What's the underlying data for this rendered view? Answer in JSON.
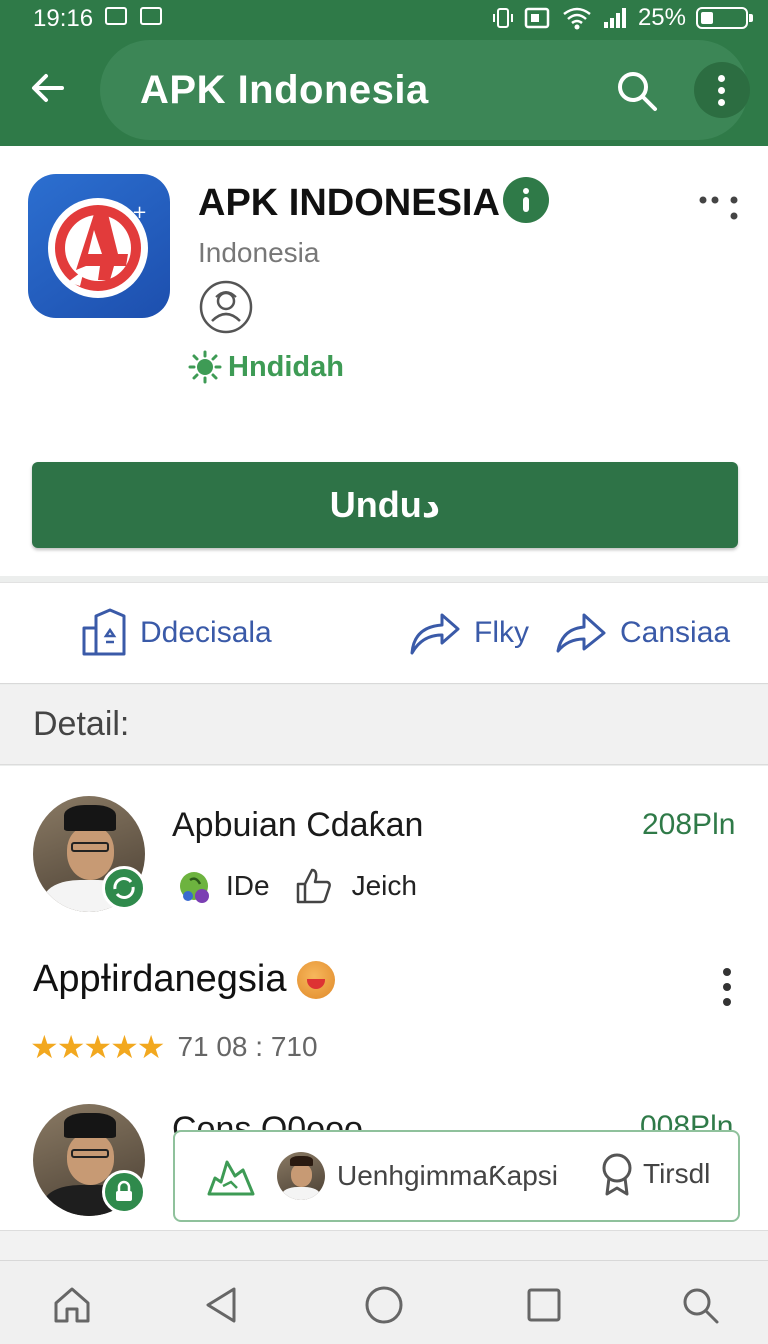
{
  "status_bar": {
    "time": "19:16",
    "battery": "25%"
  },
  "app_bar": {
    "title": "APK Indonesia",
    "icons": [
      "back-arrow-icon",
      "search-icon",
      "more-vert-icon"
    ]
  },
  "app": {
    "name": "APK INDONESIA",
    "developer": "Indonesia",
    "status": "Hndidah",
    "download_label": "Unduد"
  },
  "actions": [
    {
      "label": "Ddecisala",
      "icon": "building-icon"
    },
    {
      "label": "Flky",
      "icon": "share-curve-icon"
    },
    {
      "label": "Cansiaa",
      "icon": "forward-arrow-icon"
    }
  ],
  "section": {
    "title": "Detail:"
  },
  "items": [
    {
      "name": "Apbuian Cdaƙan",
      "size": "208Pln",
      "tag": "IDe",
      "meta": "Jeich"
    },
    {
      "name": "Cons O0ooo",
      "size": "008Pln"
    }
  ],
  "app_entry": {
    "title": "AppƗirdanegsia",
    "rating_text": "71 08 : 710",
    "stars": 4.5
  },
  "chip": {
    "label": "UenhgimmaƘapsi",
    "action": "Tirsdl"
  },
  "colors": {
    "primary": "#2f7a48",
    "accent_green": "#3e9b55",
    "link_blue": "#3a5aa8",
    "star": "#f2a81f"
  }
}
